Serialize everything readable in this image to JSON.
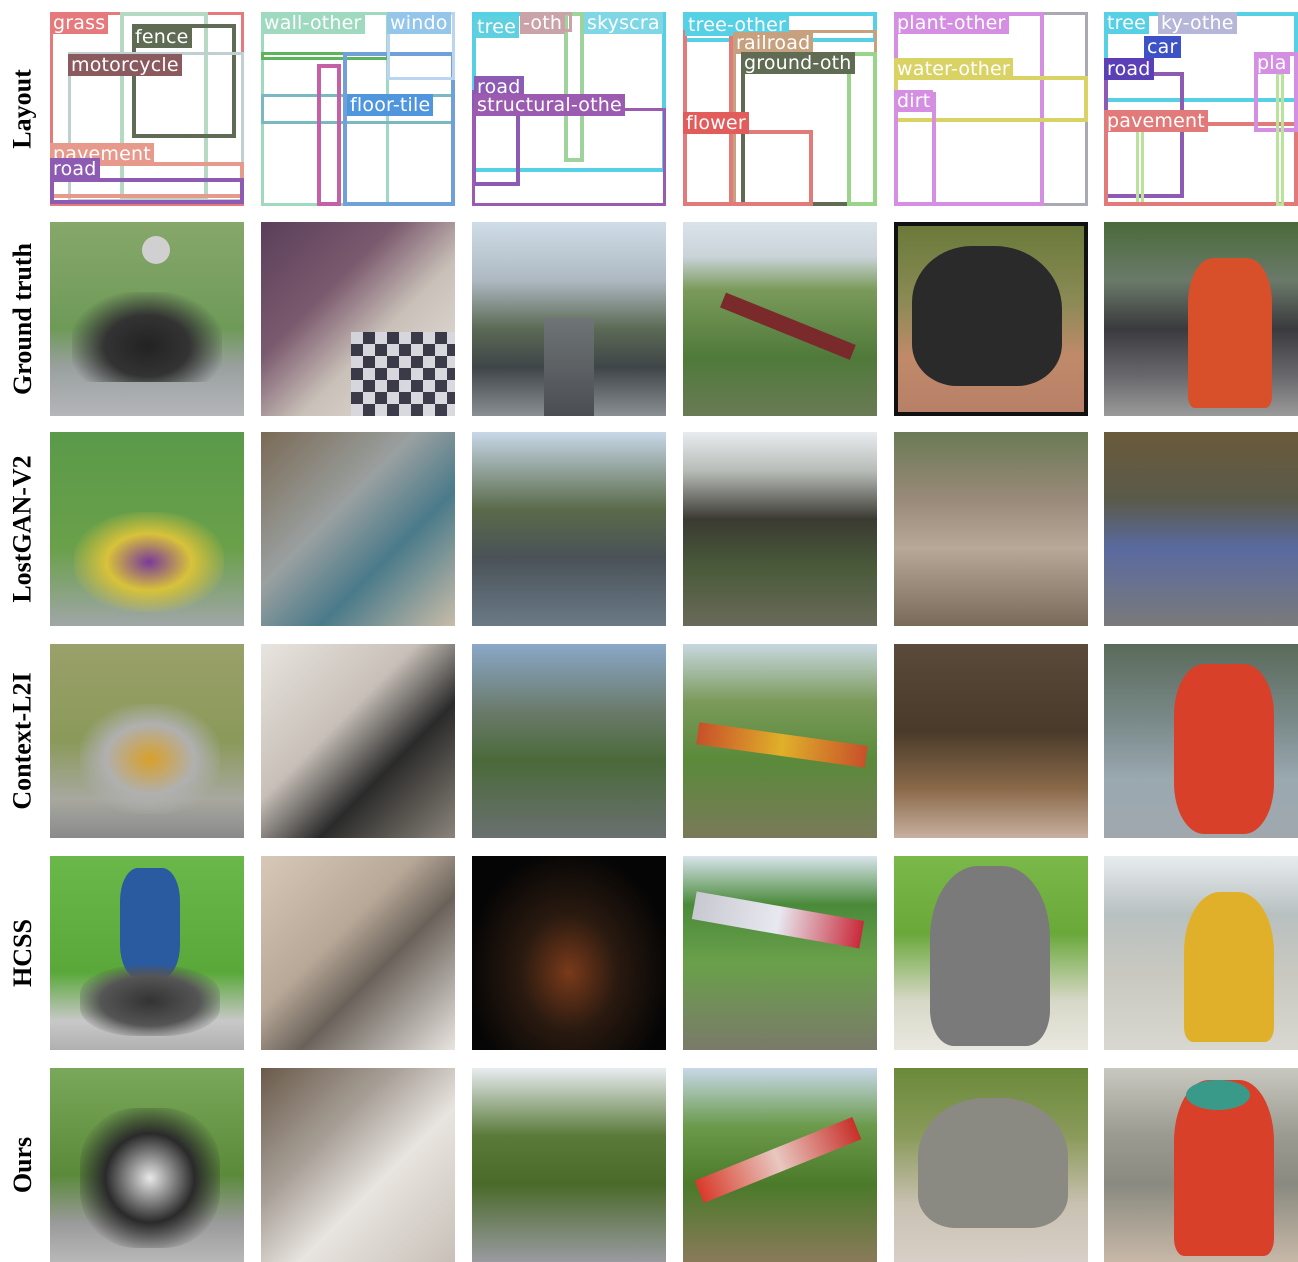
{
  "rows": [
    {
      "label": "Layout"
    },
    {
      "label": "Ground truth"
    },
    {
      "label": "LostGAN-V2"
    },
    {
      "label": "Context-L2I"
    },
    {
      "label": "HCSS"
    },
    {
      "label": "Ours"
    }
  ],
  "layouts": [
    {
      "labels": [
        "grass",
        "fence",
        "motorcycle",
        "pavement",
        "road"
      ]
    },
    {
      "labels": [
        "wall-other",
        "windo",
        "floor-tile"
      ]
    },
    {
      "labels": [
        "tree",
        "-oth",
        "skyscra",
        "road",
        "structural-othe"
      ]
    },
    {
      "labels": [
        "tree-other",
        "railroad",
        "ground-oth",
        "flower"
      ]
    },
    {
      "labels": [
        "plant-other",
        "water-other",
        "dirt"
      ]
    },
    {
      "labels": [
        "tree",
        "ky-othe",
        "car",
        "road",
        "pla",
        "pavement"
      ]
    }
  ],
  "images": [
    [
      "motorcycle rider on road",
      "kitchen with checkered floor",
      "city street with skyscrapers",
      "freight train on railroad",
      "elephant on dirt",
      "fire hydrant on pavement"
    ],
    [
      "distorted motorcycle rider",
      "blurry kitchen interior",
      "city street view",
      "distorted train",
      "elephant",
      "distorted hydrant"
    ],
    [
      "distorted motorcycle",
      "dark kitchen interior",
      "city street",
      "colorful train on hillside",
      "brown elephant",
      "red hydrant"
    ],
    [
      "rider in blue on motorcycle",
      "plain kitchen",
      "night city street",
      "red and white train",
      "gray elephant",
      "yellow fire hydrant"
    ],
    [
      "racing motorcycle",
      "modern kitchen",
      "tree-lined street",
      "red train on railroad",
      "baby elephant",
      "red fire hydrant"
    ]
  ]
}
